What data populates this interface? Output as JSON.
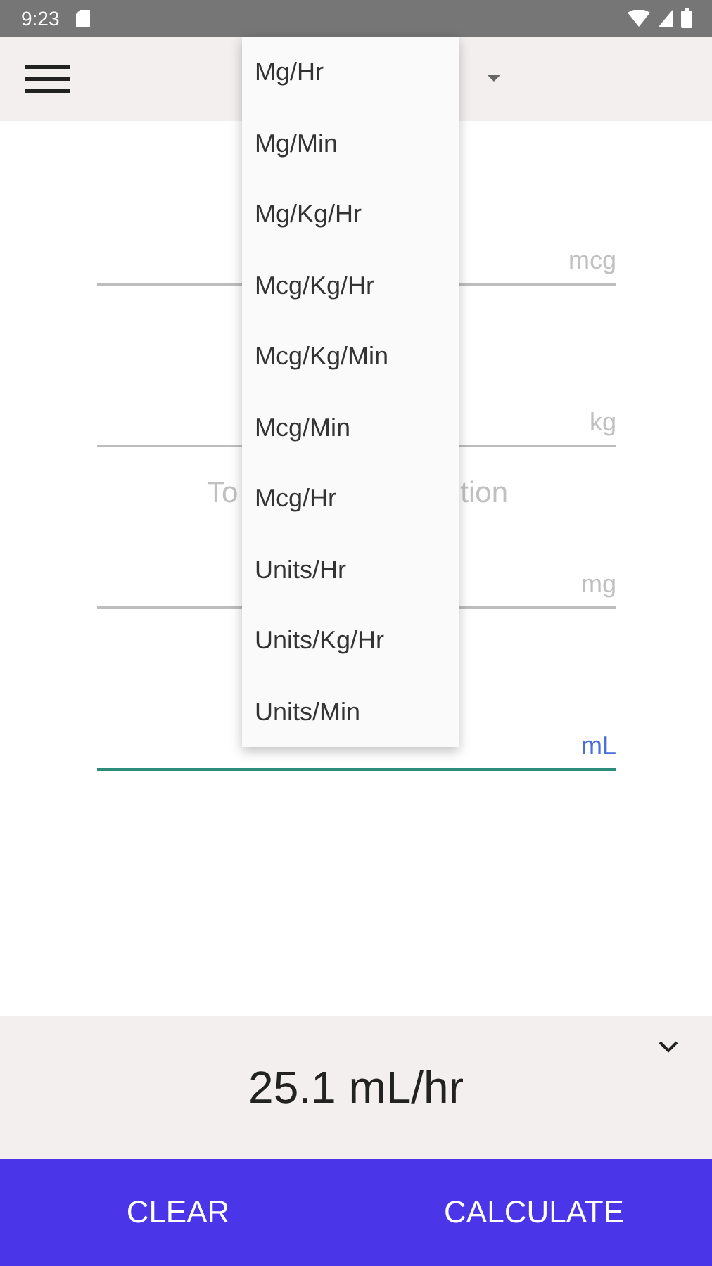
{
  "status_bar": {
    "time": "9:23"
  },
  "unit_menu": {
    "items": [
      {
        "label": "Mg/Hr"
      },
      {
        "label": "Mg/Min"
      },
      {
        "label": "Mg/Kg/Hr"
      },
      {
        "label": "Mcg/Kg/Hr"
      },
      {
        "label": "Mcg/Kg/Min"
      },
      {
        "label": "Mcg/Min"
      },
      {
        "label": "Mcg/Hr"
      },
      {
        "label": "Units/Hr"
      },
      {
        "label": "Units/Kg/Hr"
      },
      {
        "label": "Units/Min"
      }
    ]
  },
  "fields": [
    {
      "unit": "mcg",
      "focused": false
    },
    {
      "unit": "kg",
      "focused": false
    },
    {
      "heading_parts": [
        "To",
        "tion"
      ],
      "unit": "mg",
      "focused": false
    },
    {
      "unit": "mL",
      "focused": true
    }
  ],
  "result": {
    "text": "25.1 mL/hr"
  },
  "buttons": [
    {
      "label": "CLEAR"
    },
    {
      "label": "CALCULATE"
    }
  ]
}
